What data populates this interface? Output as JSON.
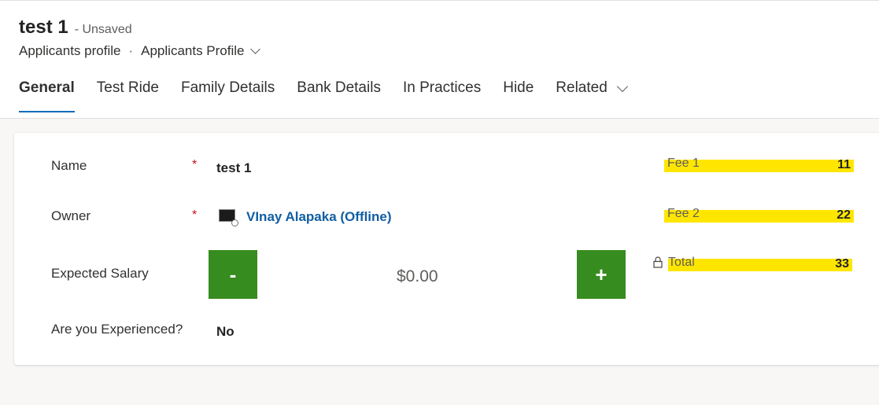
{
  "header": {
    "record_title": "test 1",
    "save_status": "- Unsaved",
    "entity_name": "Applicants profile",
    "separator": "·",
    "form_name": "Applicants Profile"
  },
  "tabs": [
    {
      "label": "General",
      "active": true
    },
    {
      "label": "Test Ride",
      "active": false
    },
    {
      "label": "Family Details",
      "active": false
    },
    {
      "label": "Bank Details",
      "active": false
    },
    {
      "label": "In Practices",
      "active": false
    },
    {
      "label": "Hide",
      "active": false
    },
    {
      "label": "Related",
      "active": false
    }
  ],
  "form": {
    "name": {
      "label": "Name",
      "required": "*",
      "value": "test 1"
    },
    "owner": {
      "label": "Owner",
      "required": "*",
      "value": "VInay Alapaka (Offline)"
    },
    "expected_salary": {
      "label": "Expected Salary",
      "minus": "-",
      "plus": "+",
      "value": "$0.00"
    },
    "experienced": {
      "label": "Are you Experienced?",
      "value": "No"
    }
  },
  "fees": {
    "fee1": {
      "label": "Fee 1",
      "value": "11"
    },
    "fee2": {
      "label": "Fee 2",
      "value": "22"
    },
    "total": {
      "label": "Total",
      "value": "33",
      "icon": "lock-icon"
    }
  },
  "colors": {
    "accent": "#0f6cbd",
    "stepper_green": "#378c1f",
    "highlight_yellow": "#ffe600",
    "required_red": "#c50f1f",
    "link_blue": "#115ea3"
  }
}
